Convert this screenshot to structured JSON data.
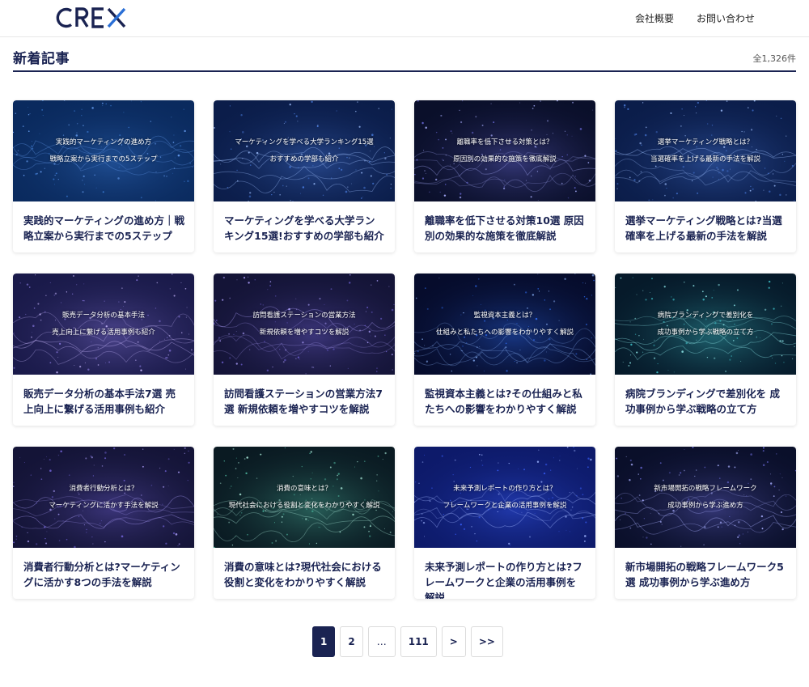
{
  "header": {
    "logo_text": "CREX",
    "nav": [
      "会社概要",
      "お問い合わせ"
    ]
  },
  "section": {
    "title": "新着記事",
    "count": "全1,326件"
  },
  "articles": [
    {
      "thumb_line1": "実践的マーケティングの進め方",
      "thumb_line2": "戦略立案から実行までの5ステップ",
      "title": "実践的マーケティングの進め方｜戦略立案から実行までの5ステップ",
      "theme": "network"
    },
    {
      "thumb_line1": "マーケティングを学べる大学ランキング15選",
      "thumb_line2": "おすすめの学部も紹介",
      "title": "マーケティングを学べる大学ランキング15選!おすすめの学部も紹介",
      "theme": "particles"
    },
    {
      "thumb_line1": "離職率を低下させる対策とは？",
      "thumb_line2": "原因別の効果的な施策を徹底解説",
      "title": "離職率を低下させる対策10選 原因別の効果的な施策を徹底解説",
      "theme": "wave"
    },
    {
      "thumb_line1": "選挙マーケティング戦略とは？",
      "thumb_line2": "当選確率を上げる最新の手法を解説",
      "title": "選挙マーケティング戦略とは?当選確率を上げる最新の手法を解説",
      "theme": "particles"
    },
    {
      "thumb_line1": "販売データ分析の基本手法",
      "thumb_line2": "売上向上に繋げる活用事例も紹介",
      "title": "販売データ分析の基本手法7選 売上向上に繋げる活用事例も紹介",
      "theme": "purple"
    },
    {
      "thumb_line1": "訪問看護ステーションの営業方法",
      "thumb_line2": "新規依頼を増やすコツを解説",
      "title": "訪問看護ステーションの営業方法7選 新規依頼を増やすコツを解説",
      "theme": "purplewave"
    },
    {
      "thumb_line1": "監視資本主義とは？",
      "thumb_line2": "仕組みと私たちへの影響をわかりやすく解説",
      "title": "監視資本主義とは?その仕組みと私たちへの影響をわかりやすく解説",
      "theme": "bluewave"
    },
    {
      "thumb_line1": "病院ブランディングで差別化を",
      "thumb_line2": "成功事例から学ぶ戦略の立て方",
      "title": "病院ブランディングで差別化を 成功事例から学ぶ戦略の立て方",
      "theme": "teal"
    },
    {
      "thumb_line1": "消費者行動分析とは？",
      "thumb_line2": "マーケティングに活かす手法を解説",
      "title": "消費者行動分析とは?マーケティングに活かす8つの手法を解説",
      "theme": "purplewave"
    },
    {
      "thumb_line1": "消費の意味とは？",
      "thumb_line2": "現代社会における役割と変化をわかりやすく解説",
      "title": "消費の意味とは?現代社会における役割と変化をわかりやすく解説",
      "theme": "green"
    },
    {
      "thumb_line1": "未来予測レポートの作り方とは？",
      "thumb_line2": "フレームワークと企業の活用事例を解説",
      "title": "未来予測レポートの作り方とは?フレームワークと企業の活用事例を解説",
      "theme": "royal"
    },
    {
      "thumb_line1": "新市場開拓の戦略フレームワーク",
      "thumb_line2": "成功事例から学ぶ進め方",
      "title": "新市場開拓の戦略フレームワーク5選 成功事例から学ぶ進め方",
      "theme": "wave"
    }
  ],
  "pagination": {
    "current": "1",
    "next_page": "2",
    "ellipsis": "…",
    "last_page": "111",
    "next": ">",
    "last": ">>"
  },
  "colors": {
    "brand_navy": "#1a2352",
    "network": "#0a2a5e",
    "particles": "#0b1d4a",
    "wave": "#0a0f2a",
    "purple": "#1a1a4a",
    "purplewave": "#141437",
    "bluewave": "#060c2c",
    "teal": "#061a2a",
    "green": "#0a1a22",
    "royal": "#0d1a6a"
  }
}
